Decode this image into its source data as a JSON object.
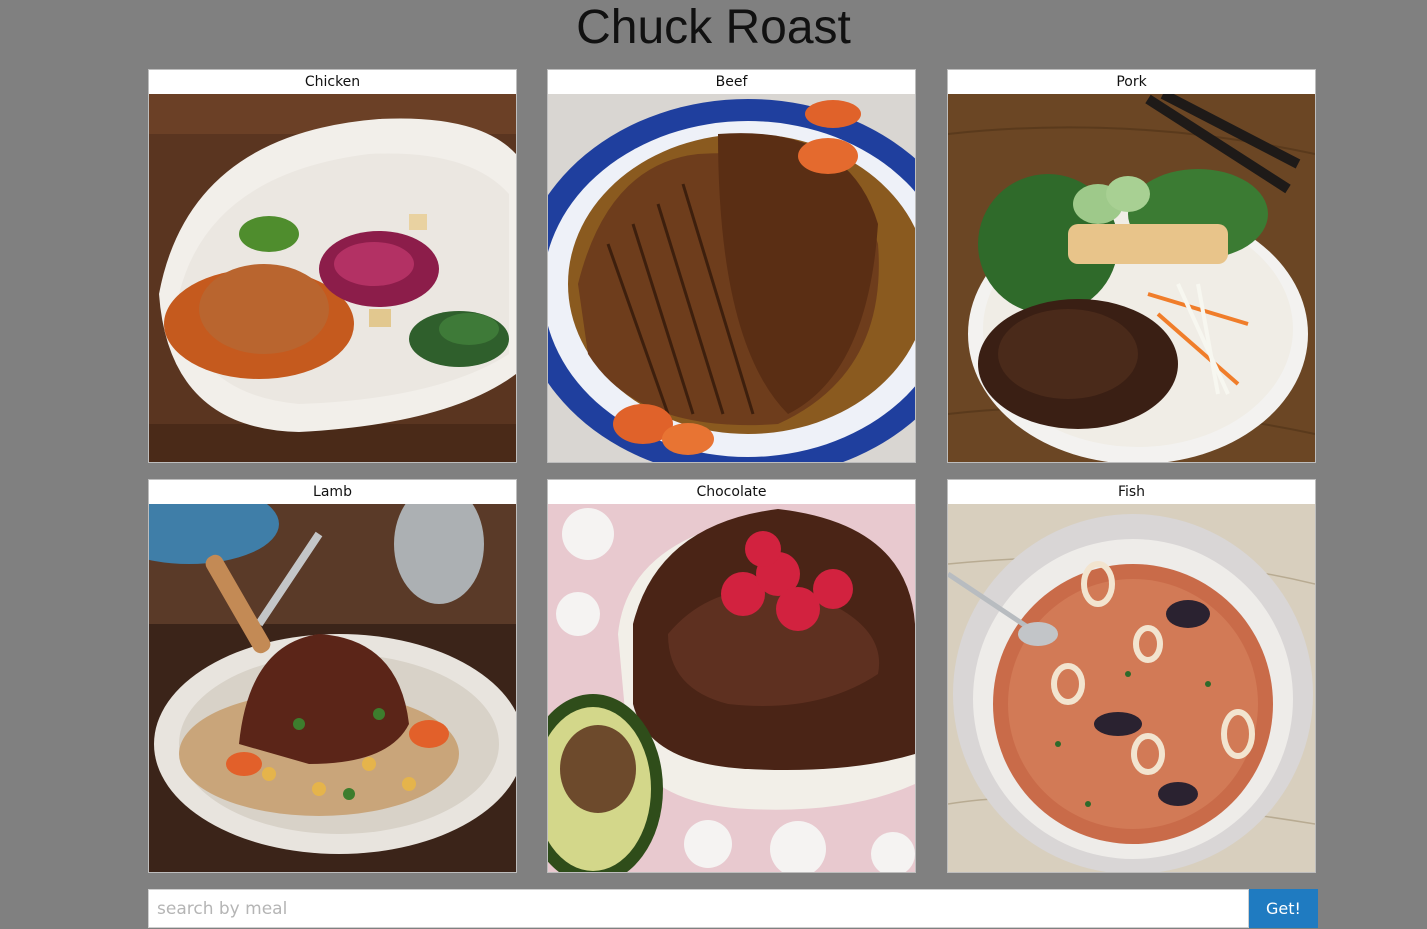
{
  "header": {
    "title": "Chuck Roast"
  },
  "meals": [
    {
      "label": "Chicken",
      "icon": "chicken-dish-photo"
    },
    {
      "label": "Beef",
      "icon": "beef-brisket-photo"
    },
    {
      "label": "Pork",
      "icon": "pork-bowl-photo"
    },
    {
      "label": "Lamb",
      "icon": "lamb-shank-photo"
    },
    {
      "label": "Chocolate",
      "icon": "chocolate-pudding-photo"
    },
    {
      "label": "Fish",
      "icon": "seafood-stew-photo"
    }
  ],
  "search": {
    "placeholder": "search by meal",
    "value": "",
    "button_label": "Get!"
  },
  "colors": {
    "background": "#808080",
    "button": "#1f7bc1"
  }
}
